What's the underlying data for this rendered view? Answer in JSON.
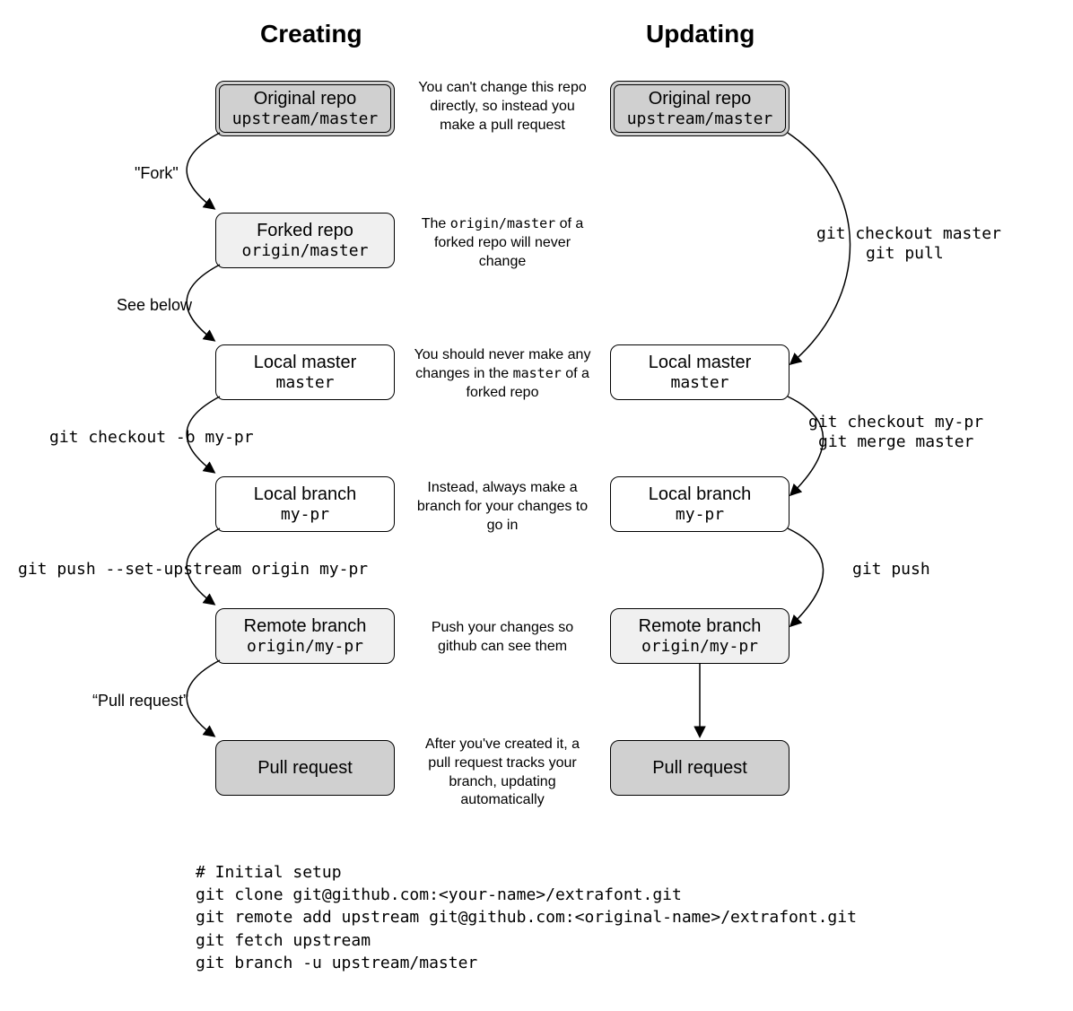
{
  "headings": {
    "creating": "Creating",
    "updating": "Updating"
  },
  "nodes": {
    "c1": {
      "title": "Original repo",
      "sub": "upstream/master"
    },
    "c2": {
      "title": "Forked repo",
      "sub": "origin/master"
    },
    "c3": {
      "title": "Local master",
      "sub": "master"
    },
    "c4": {
      "title": "Local branch",
      "sub": "my-pr"
    },
    "c5": {
      "title": "Remote branch",
      "sub": "origin/my-pr"
    },
    "c6": {
      "title": "Pull request"
    },
    "u1": {
      "title": "Original repo",
      "sub": "upstream/master"
    },
    "u2": {
      "title": "Local master",
      "sub": "master"
    },
    "u3": {
      "title": "Local branch",
      "sub": "my-pr"
    },
    "u4": {
      "title": "Remote branch",
      "sub": "origin/my-pr"
    },
    "u5": {
      "title": "Pull request"
    }
  },
  "descriptions": {
    "d1": "You can't change this repo directly, so instead you make a pull request",
    "d2_pre": "The ",
    "d2_code": "origin/master",
    "d2_post": " of a forked repo will never change",
    "d3_pre": "You should never make any changes in the ",
    "d3_code": "master",
    "d3_post": " of a forked repo",
    "d4": "Instead, always make a branch for your changes to go in",
    "d5": "Push your changes so github can see them",
    "d6": "After you've created it, a pull request tracks your branch, updating automatically"
  },
  "edges": {
    "e1": "\"Fork\"",
    "e2": "See below",
    "e3": "git checkout -b my-pr",
    "e4": "git push --set-upstream origin my-pr",
    "e5": "“Pull request”",
    "u_e1a": "git checkout master",
    "u_e1b": "git pull",
    "u_e2a": "git checkout my-pr",
    "u_e2b": "git merge master",
    "u_e3": "git push"
  },
  "setup": "# Initial setup\ngit clone git@github.com:<your-name>/extrafont.git\ngit remote add upstream git@github.com:<original-name>/extrafont.git\ngit fetch upstream\ngit branch -u upstream/master"
}
